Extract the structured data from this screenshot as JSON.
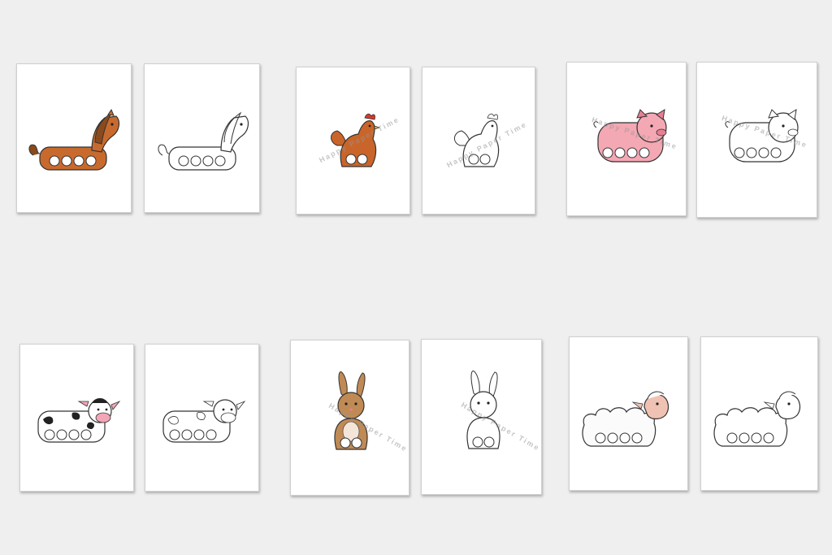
{
  "watermark": "Happy Paper Time",
  "colors": {
    "background": "#efefef",
    "horse": "#c86a2e",
    "horse_mane": "#8b4a1c",
    "hen": "#c9652a",
    "hen_comb": "#d63a2a",
    "pig": "#f4a8b4",
    "cow_spots": "#222222",
    "cow_nose": "#f3a6b6",
    "bunny": "#c08a55",
    "sheep_face": "#f0c2b4",
    "outline": "#333333"
  },
  "sheets": [
    {
      "animal": "horse",
      "style": "color"
    },
    {
      "animal": "horse",
      "style": "outline"
    },
    {
      "animal": "hen",
      "style": "color"
    },
    {
      "animal": "hen",
      "style": "outline"
    },
    {
      "animal": "pig",
      "style": "color"
    },
    {
      "animal": "pig",
      "style": "outline"
    },
    {
      "animal": "cow",
      "style": "color"
    },
    {
      "animal": "cow",
      "style": "outline"
    },
    {
      "animal": "bunny",
      "style": "color"
    },
    {
      "animal": "bunny",
      "style": "outline"
    },
    {
      "animal": "sheep",
      "style": "color"
    },
    {
      "animal": "sheep",
      "style": "outline"
    }
  ]
}
